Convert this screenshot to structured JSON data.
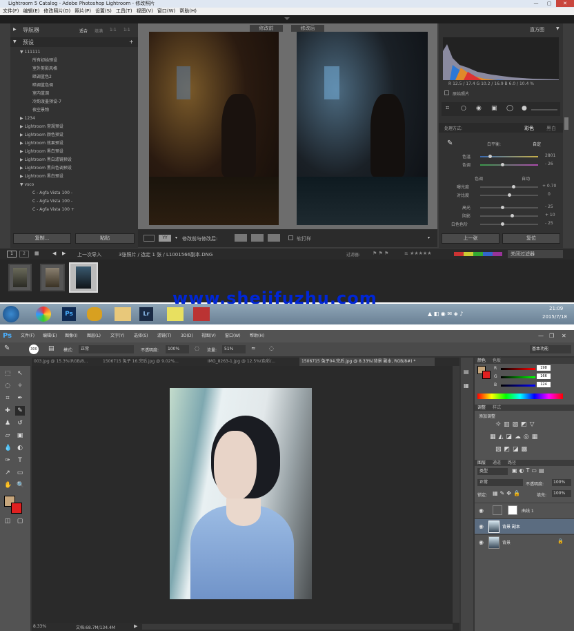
{
  "lr": {
    "title": "Lightroom 5 Catalog - Adobe Photoshop Lightroom - 修改照片",
    "menu": [
      "文件(F)",
      "编辑(E)",
      "修改照片(D)",
      "照片(P)",
      "设置(S)",
      "工具(T)",
      "视图(V)",
      "窗口(W)",
      "帮助(H)"
    ],
    "navigator": {
      "label": "导航器",
      "zooms": [
        "适合",
        "填满",
        "1:1",
        "1:1"
      ]
    },
    "presets": {
      "label": "预设",
      "items": [
        "▼ 111111",
        "所有初始预设",
        "室外剪影风格",
        "暗调蓝色2",
        "暗调蓝色调",
        "室内蓝调",
        "冷韵泼墨预设-7",
        "夜空景物",
        "▶ 1234",
        "▶ Lightroom 常规预设",
        "▶ Lightroom 颜色预设",
        "▶ Lightroom 效果预设",
        "▶ Lightroom 黑白预设",
        "▶ Lightroom 黑白滤镜预设",
        "▶ Lightroom 黑白色调预设",
        "▶ Lightroom 黑白预设",
        "▼ vsco",
        "C - Agfa Vista 100 -",
        "C - Agfa Vista 100 -",
        "C - Agfa Vista 100 +"
      ]
    },
    "left_buttons": {
      "copy": "复制...",
      "paste": "粘贴"
    },
    "before_label": "修改前",
    "after_label": "修改后",
    "toolbar": {
      "compare": "修改前与修改后:",
      "softproof": "软打样"
    },
    "histogram": {
      "label": "直方图",
      "readout": "R 12.5 / 17.4  G 10.2 / 16.9  B 6.0 / 10.4 %",
      "original": "原始照片"
    },
    "basic": {
      "treatment": "处理方式:",
      "color": "彩色",
      "bw": "黑白",
      "wb": "白平衡:",
      "wb_value": "自定",
      "temp": {
        "label": "色温",
        "value": "2801"
      },
      "tint": {
        "label": "色调",
        "value": "- 26"
      },
      "tone": "色调",
      "auto": "自动",
      "exposure": {
        "label": "曝光度",
        "value": "+ 0.70"
      },
      "contrast": {
        "label": "对比度",
        "value": "0"
      },
      "highlights": {
        "label": "高光",
        "value": "- 25"
      },
      "shadows": {
        "label": "阴影",
        "value": "+ 10"
      },
      "whites": {
        "label": "白色色阶",
        "value": "- 25"
      }
    },
    "right_buttons": {
      "prev": "上一张",
      "reset": "复位"
    },
    "filmstrip": {
      "pages": [
        "1",
        "2"
      ],
      "source": "上一次导入",
      "info": "3张照片 / 选定 1 张 / L1001566副本.DNG",
      "filter": "过滤器:",
      "filter_value": "关闭过滤器"
    }
  },
  "watermark": "www.shejifuzhu.com",
  "taskbar": {
    "time": "21:09",
    "date": "2015/7/18"
  },
  "ps": {
    "logo": "Ps",
    "menu": [
      "文件(F)",
      "编辑(E)",
      "图像(I)",
      "图层(L)",
      "文字(Y)",
      "选择(S)",
      "滤镜(T)",
      "3D(D)",
      "视图(V)",
      "窗口(W)",
      "帮助(H)"
    ],
    "options": {
      "mode_label": "模式:",
      "mode_value": "正常",
      "opacity_label": "不透明度:",
      "opacity_value": "100%",
      "flow_label": "流量:",
      "flow_value": "51%",
      "brush_size": "300",
      "workspace": "基本功能"
    },
    "tabs": [
      "003.jpg @ 15.3%(RGB/8...",
      "1506715 兔子 16.完后.jpg @ 9.02%...",
      "IMG_8263-1.jpg @ 12.5%(色彩/...",
      "1506715 兔子04.完后.jpg @ 8.33%(背景 副本, RGB/8#) *"
    ],
    "status": {
      "zoom": "8.33%",
      "doc": "文档:68.7M/134.4M"
    },
    "color_panel": {
      "tabs": [
        "颜色",
        "色板"
      ],
      "r": "198",
      "g": "166",
      "b": "124"
    },
    "adjust": {
      "tabs": [
        "调整",
        "样式"
      ],
      "label": "添加调整"
    },
    "layers": {
      "tabs": [
        "图层",
        "通道",
        "路径"
      ],
      "kind": "类型",
      "blend": "正常",
      "opacity_label": "不透明度:",
      "opacity": "100%",
      "lock_label": "锁定:",
      "fill_label": "填充:",
      "fill": "100%",
      "items": [
        "曲线 1",
        "背景 副本",
        "背景"
      ]
    }
  }
}
